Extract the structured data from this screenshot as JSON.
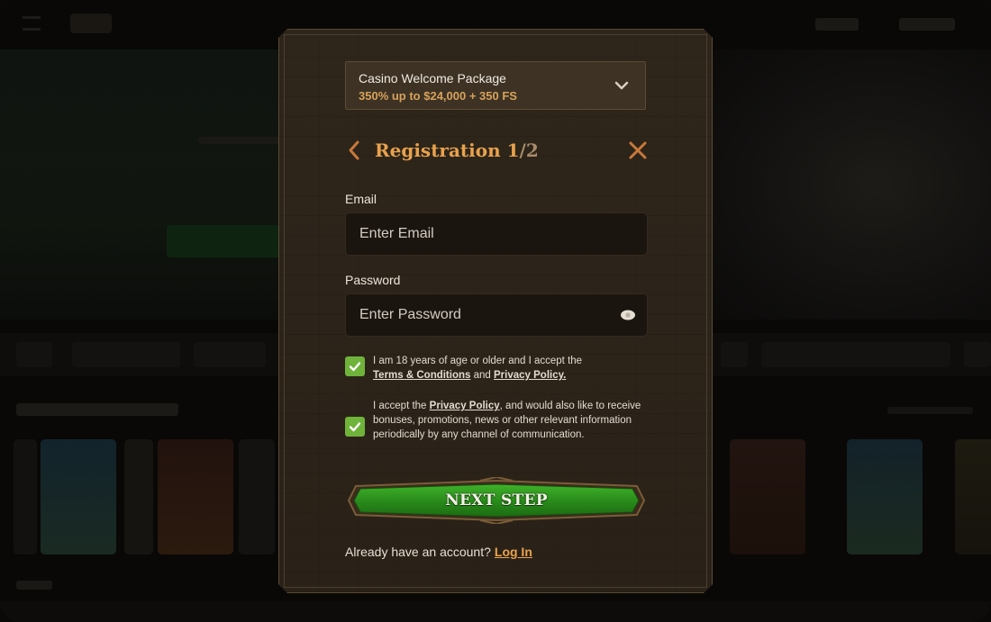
{
  "promo": {
    "title": "Casino Welcome Package",
    "subtitle": "350% up to $24,000 + 350 FS"
  },
  "registration": {
    "title": "Registration 1",
    "step_total": "/2"
  },
  "form": {
    "email_label": "Email",
    "email_placeholder": "Enter Email",
    "password_label": "Password",
    "password_placeholder": "Enter Password"
  },
  "consents": {
    "age": {
      "text": "I am 18 years of age or older and I accept the",
      "terms_link": "Terms & Conditions",
      "and": "and",
      "privacy_link": "Privacy Policy.",
      "checked": true
    },
    "marketing": {
      "prefix": "I accept the",
      "privacy_link": "Privacy Policy",
      "suffix": ", and would also like to receive bonuses, promotions, news or other relevant information periodically by any channel of communication.",
      "checked": true
    }
  },
  "next_button": "NEXT STEP",
  "login": {
    "prompt": "Already have an account?",
    "link": "Log In"
  },
  "colors": {
    "accent": "#e8a24d",
    "modal_bg": "#2c2419",
    "input_bg": "#1b1510",
    "checkbox": "#6fb33a",
    "button_green": "#2f8f1f"
  },
  "icons": [
    "chevron-down-icon",
    "chevron-left-icon",
    "close-icon",
    "eye-icon",
    "checkmark-icon"
  ]
}
